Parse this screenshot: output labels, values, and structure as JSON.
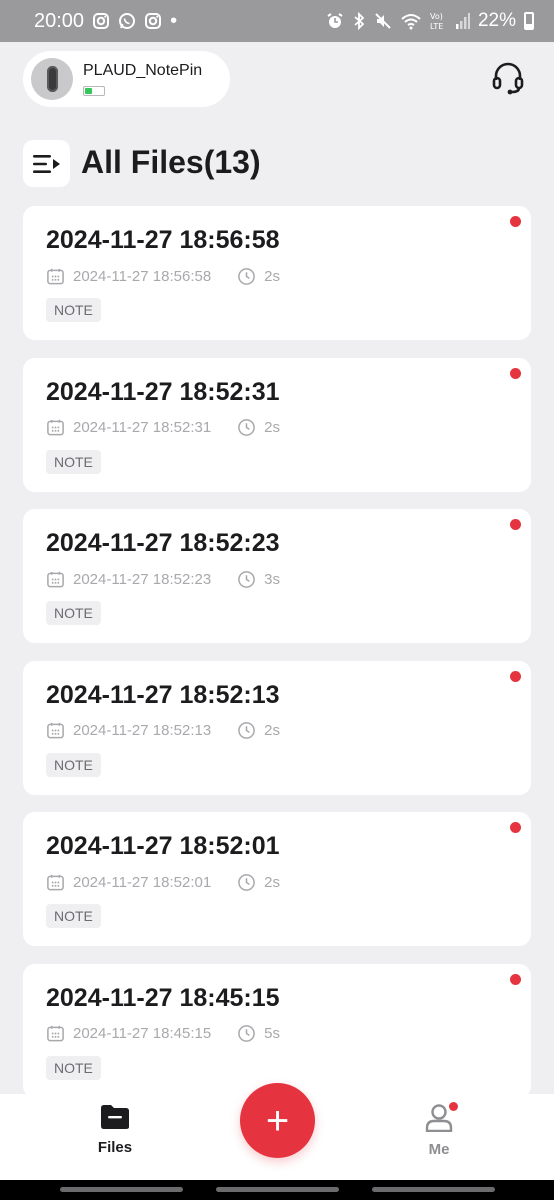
{
  "status_bar": {
    "time": "20:00",
    "battery_percent": "22%",
    "left_icons": [
      "instagram-icon",
      "whatsapp-icon",
      "instagram-icon"
    ],
    "right_icons": [
      "alarm-icon",
      "bluetooth-icon",
      "mute-icon",
      "wifi-icon",
      "volte-icon",
      "signal-icon",
      "battery-icon"
    ]
  },
  "device": {
    "name": "PLAUD_NotePin",
    "battery_level": 0.4,
    "battery_color": "#34c759"
  },
  "header": {
    "title": "All Files(13)"
  },
  "files": [
    {
      "title": "2024-11-27 18:56:58",
      "date": "2024-11-27 18:56:58",
      "duration": "2s",
      "tag": "NOTE",
      "unread": true
    },
    {
      "title": "2024-11-27 18:52:31",
      "date": "2024-11-27 18:52:31",
      "duration": "2s",
      "tag": "NOTE",
      "unread": true
    },
    {
      "title": "2024-11-27 18:52:23",
      "date": "2024-11-27 18:52:23",
      "duration": "3s",
      "tag": "NOTE",
      "unread": true
    },
    {
      "title": "2024-11-27 18:52:13",
      "date": "2024-11-27 18:52:13",
      "duration": "2s",
      "tag": "NOTE",
      "unread": true
    },
    {
      "title": "2024-11-27 18:52:01",
      "date": "2024-11-27 18:52:01",
      "duration": "2s",
      "tag": "NOTE",
      "unread": true
    },
    {
      "title": "2024-11-27 18:45:15",
      "date": "2024-11-27 18:45:15",
      "duration": "5s",
      "tag": "NOTE",
      "unread": true
    }
  ],
  "bottom_nav": {
    "files_label": "Files",
    "me_label": "Me",
    "add_label": "+",
    "accent_color": "#e5343f"
  }
}
